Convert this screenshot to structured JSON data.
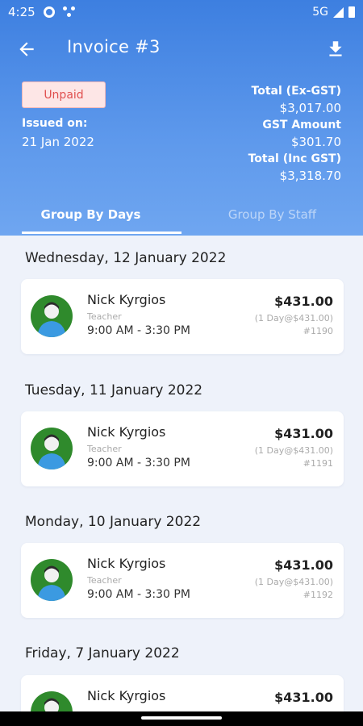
{
  "status_bar": {
    "time": "4:25",
    "network": "5G"
  },
  "app_bar": {
    "title": "Invoice #3",
    "back_icon": "arrow-left-icon",
    "download_icon": "download-icon"
  },
  "invoice": {
    "status": "Unpaid",
    "issued_label": "Issued on:",
    "issued_date": "21 Jan 2022",
    "total_ex_gst_label": "Total (Ex-GST)",
    "total_ex_gst": "$3,017.00",
    "gst_label": "GST Amount",
    "gst": "$301.70",
    "total_inc_gst_label": "Total (Inc GST)",
    "total_inc_gst": "$3,318.70"
  },
  "tabs": [
    {
      "label": "Group By Days",
      "active": true
    },
    {
      "label": "Group By Staff",
      "active": false
    }
  ],
  "groups": [
    {
      "day": "Wednesday, 12 January 2022",
      "entry": {
        "name": "Nick Kyrgios",
        "role": "Teacher",
        "time": "9:00 AM - 3:30 PM",
        "amount": "$431.00",
        "days": "(1 Day@$431.00)",
        "ref": "#1190"
      }
    },
    {
      "day": "Tuesday, 11 January 2022",
      "entry": {
        "name": "Nick Kyrgios",
        "role": "Teacher",
        "time": "9:00 AM - 3:30 PM",
        "amount": "$431.00",
        "days": "(1 Day@$431.00)",
        "ref": "#1191"
      }
    },
    {
      "day": "Monday, 10 January 2022",
      "entry": {
        "name": "Nick Kyrgios",
        "role": "Teacher",
        "time": "9:00 AM - 3:30 PM",
        "amount": "$431.00",
        "days": "(1 Day@$431.00)",
        "ref": "#1192"
      }
    },
    {
      "day": "Friday, 7 January 2022",
      "entry": {
        "name": "Nick Kyrgios",
        "amount": "$431.00"
      }
    }
  ],
  "colors": {
    "header_top": "#3d7fe0",
    "header_bottom": "#6fa6f0",
    "unpaid_text": "#e0504f",
    "unpaid_bg": "#fde6e6",
    "avatar_bg": "#2f8a2c",
    "background": "#eef2fa"
  }
}
